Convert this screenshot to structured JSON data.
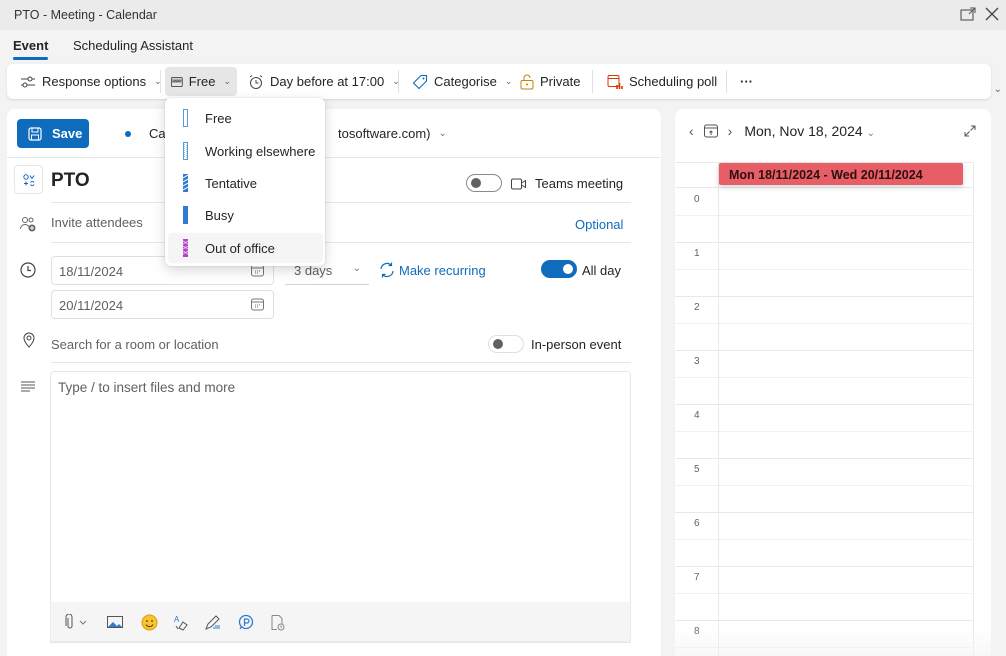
{
  "window": {
    "title": "PTO - Meeting - Calendar",
    "popout_icon": "popout-icon",
    "close_icon": "close-icon"
  },
  "tabs": [
    {
      "label": "Event",
      "active": true
    },
    {
      "label": "Scheduling Assistant",
      "active": false
    }
  ],
  "ribbon": {
    "response_options": "Response options",
    "show_as": "Free",
    "reminder": "Day before at 17:00",
    "categorise": "Categorise",
    "private": "Private",
    "scheduling_poll": "Scheduling poll",
    "more": "···"
  },
  "show_as_menu": {
    "items": [
      {
        "label": "Free",
        "color": "#5b9bd5",
        "pattern": "outline"
      },
      {
        "label": "Working elsewhere",
        "color": "#5b9bd5",
        "pattern": "dotted"
      },
      {
        "label": "Tentative",
        "color": "#2f7bd1",
        "pattern": "striped"
      },
      {
        "label": "Busy",
        "color": "#2f7bd1",
        "pattern": "solid"
      },
      {
        "label": "Out of office",
        "color": "#b146c2",
        "pattern": "checkered"
      }
    ],
    "hovered": "Out of office"
  },
  "form": {
    "save_label": "Save",
    "calendar_prefix": "Cal",
    "calendar_suffix": "tosoftware.com)",
    "event_title": "PTO",
    "teams_meeting_label": "Teams meeting",
    "teams_meeting_on": false,
    "invite_placeholder": "Invite attendees",
    "optional_label": "Optional",
    "start_date": "18/11/2024",
    "end_date": "20/11/2024",
    "duration": "3 days",
    "make_recurring": "Make recurring",
    "all_day_label": "All day",
    "all_day_on": true,
    "location_placeholder": "Search for a room or location",
    "in_person_label": "In-person event",
    "in_person_on": false,
    "body_placeholder": "Type / to insert files and more"
  },
  "editor_toolbar": [
    "attach-icon",
    "insert-image-icon",
    "emoji-icon",
    "format-text-icon",
    "draw-icon",
    "loop-icon",
    "immersive-reader-icon"
  ],
  "calendar": {
    "date_label": "Mon, Nov 18, 2024",
    "event_label": "Mon 18/11/2024 - Wed 20/11/2024",
    "event_color": "#e85e66",
    "hours": [
      "0",
      "1",
      "2",
      "3",
      "4",
      "5",
      "6",
      "7",
      "8"
    ]
  },
  "colors": {
    "accent": "#0f6cbd",
    "out_of_office": "#b146c2"
  }
}
